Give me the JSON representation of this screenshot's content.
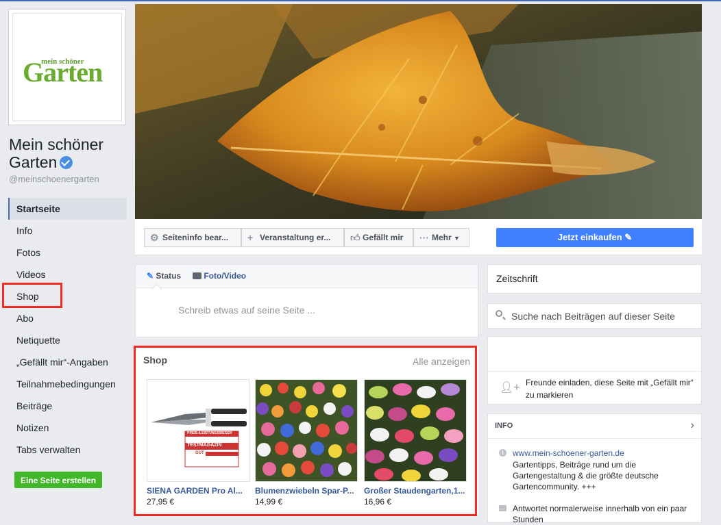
{
  "page": {
    "logo_small": "mein schöner",
    "logo_big": "Garten",
    "name": "Mein schöner Garten",
    "handle": "@meinschoenergarten"
  },
  "nav": {
    "items": [
      "Startseite",
      "Info",
      "Fotos",
      "Videos",
      "Shop",
      "Abo",
      "Netiquette",
      "„Gefällt mir“-Angaben",
      "Teilnahmebedingungen",
      "Beiträge",
      "Notizen",
      "Tabs verwalten"
    ],
    "active": "Startseite",
    "create_page": "Eine Seite erstellen"
  },
  "actions": {
    "edit_info": "Seiteninfo bear...",
    "event": "Veranstaltung er...",
    "like": "Gefällt mir",
    "more": "Mehr",
    "shop_now": "Jetzt einkaufen"
  },
  "composer": {
    "status_tab": "Status",
    "photo_tab": "Foto/Video",
    "placeholder": "Schreib etwas auf seine Seite ..."
  },
  "shop": {
    "title": "Shop",
    "see_all": "Alle anzeigen",
    "products": [
      {
        "name": "SIENA GARDEN Pro Al...",
        "price": "27,95 €"
      },
      {
        "name": "Blumenzwiebeln Spar-P...",
        "price": "14,99 €"
      },
      {
        "name": "Großer Staudengarten,1...",
        "price": "16,96 €"
      }
    ],
    "product_badge": {
      "line1": "PREIS-/LEISTUNGSSIEGER",
      "line2": "TESTMAGAZIN",
      "line3": "GUT"
    }
  },
  "sidebar_right": {
    "category": "Zeitschrift",
    "search_placeholder": "Suche nach Beiträgen auf dieser Seite",
    "invite_text": "Freunde einladen, diese Seite mit „Gefällt mir“ zu markieren",
    "info_header": "INFO",
    "website": "www.mein-schoener-garten.de",
    "description": "Gartentipps, Beiträge rund um die Gartengestaltung & die größte deutsche Gartencommunity. +++",
    "response": "Antwortet normalerweise innerhalb von ein paar Stunden"
  },
  "colors": {
    "accent_blue": "#4267b2",
    "button_blue": "#4080ff",
    "green": "#42b72a",
    "highlight_red": "#f02d25",
    "link": "#365899"
  }
}
